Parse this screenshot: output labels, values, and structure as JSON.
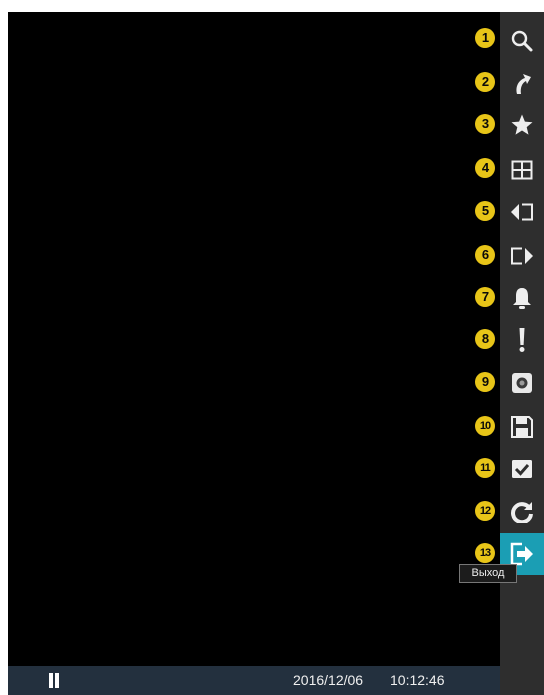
{
  "status_bar": {
    "date": "2016/12/06",
    "time": "10:12:46"
  },
  "menu": {
    "items": [
      {
        "num": "1",
        "icon": "search-icon"
      },
      {
        "num": "2",
        "icon": "arrow-jump-icon"
      },
      {
        "num": "3",
        "icon": "star-icon"
      },
      {
        "num": "4",
        "icon": "grid-layout-icon"
      },
      {
        "num": "5",
        "icon": "previous-group-icon"
      },
      {
        "num": "6",
        "icon": "next-group-icon"
      },
      {
        "num": "7",
        "icon": "bell-icon"
      },
      {
        "num": "8",
        "icon": "exclamation-icon"
      },
      {
        "num": "9",
        "icon": "camera-icon"
      },
      {
        "num": "10",
        "icon": "save-icon"
      },
      {
        "num": "11",
        "icon": "checkbox-icon"
      },
      {
        "num": "12",
        "icon": "refresh-icon"
      },
      {
        "num": "13",
        "icon": "exit-icon"
      }
    ],
    "active_index": 12,
    "exit_tooltip": "Выход"
  },
  "colors": {
    "active": "#1b9eb4",
    "badge": "#e8c518",
    "sidebar": "#2e2e2e",
    "status_bar": "#23303e"
  }
}
